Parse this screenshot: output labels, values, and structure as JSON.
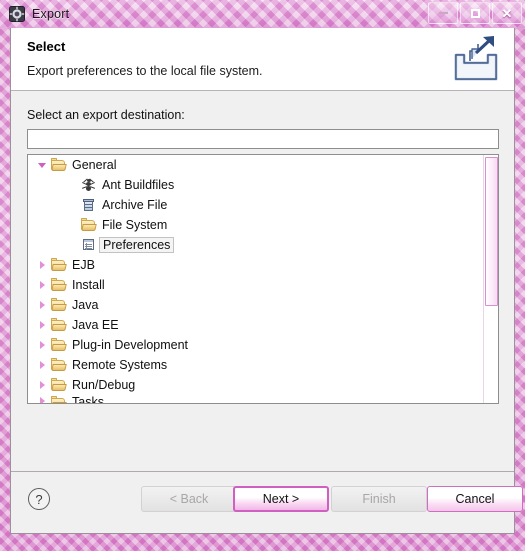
{
  "window": {
    "title": "Export",
    "app_icon": "eclipse-icon",
    "controls": {
      "minimize": "minimize-icon",
      "maximize": "maximize-icon",
      "close": "close-icon"
    }
  },
  "banner": {
    "title": "Select",
    "description": "Export preferences to the local file system.",
    "icon": "export-wizard-icon"
  },
  "main": {
    "destination_label": "Select an export destination:",
    "filter": {
      "value": "",
      "placeholder": ""
    },
    "tree": [
      {
        "label": "General",
        "icon": "folder-icon",
        "expanded": true,
        "level": 0,
        "selected": false,
        "clipped": false
      },
      {
        "label": "Ant Buildfiles",
        "icon": "ant-icon",
        "expanded": null,
        "level": 1,
        "selected": false,
        "clipped": false
      },
      {
        "label": "Archive File",
        "icon": "archive-icon",
        "expanded": null,
        "level": 1,
        "selected": false,
        "clipped": false
      },
      {
        "label": "File System",
        "icon": "folder-icon",
        "expanded": null,
        "level": 1,
        "selected": false,
        "clipped": false
      },
      {
        "label": "Preferences",
        "icon": "preferences-icon",
        "expanded": null,
        "level": 1,
        "selected": true,
        "clipped": false
      },
      {
        "label": "EJB",
        "icon": "folder-icon",
        "expanded": false,
        "level": 0,
        "selected": false,
        "clipped": false
      },
      {
        "label": "Install",
        "icon": "folder-icon",
        "expanded": false,
        "level": 0,
        "selected": false,
        "clipped": false
      },
      {
        "label": "Java",
        "icon": "folder-icon",
        "expanded": false,
        "level": 0,
        "selected": false,
        "clipped": false
      },
      {
        "label": "Java EE",
        "icon": "folder-icon",
        "expanded": false,
        "level": 0,
        "selected": false,
        "clipped": false
      },
      {
        "label": "Plug-in Development",
        "icon": "folder-icon",
        "expanded": false,
        "level": 0,
        "selected": false,
        "clipped": false
      },
      {
        "label": "Remote Systems",
        "icon": "folder-icon",
        "expanded": false,
        "level": 0,
        "selected": false,
        "clipped": false
      },
      {
        "label": "Run/Debug",
        "icon": "folder-icon",
        "expanded": false,
        "level": 0,
        "selected": false,
        "clipped": false
      },
      {
        "label": "Tasks",
        "icon": "folder-icon",
        "expanded": false,
        "level": 0,
        "selected": false,
        "clipped": true
      }
    ],
    "scrollbar": {
      "orientation": "vertical",
      "thumb_position_percent": 1,
      "thumb_size_percent": 60
    }
  },
  "footer": {
    "help_label": "?",
    "buttons": [
      {
        "label": "< Back",
        "state": "disabled"
      },
      {
        "label": "Next >",
        "state": "default"
      },
      {
        "label": "Finish",
        "state": "disabled"
      },
      {
        "label": "Cancel",
        "state": "enabled"
      }
    ]
  },
  "colors": {
    "accent": "#cf5fc0",
    "title_gradient_start": "#e9b6e2",
    "title_gradient_end": "#cf77c4",
    "dialog_bg": "#f0f0f0",
    "field_bg": "#ffffff",
    "folder": "#f0cf7c"
  }
}
